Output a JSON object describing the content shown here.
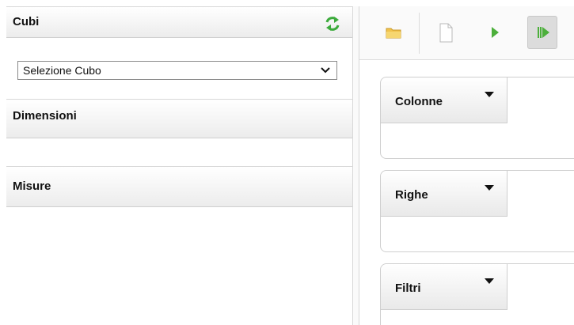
{
  "left_panel": {
    "cubi": {
      "title": "Cubi",
      "refresh_icon": "refresh-icon"
    },
    "cube_select": {
      "selected": "Selezione Cubo",
      "chevron": "chevron-down-icon"
    },
    "dimensioni": {
      "title": "Dimensioni"
    },
    "misure": {
      "title": "Misure"
    }
  },
  "toolbar": {
    "buttons": [
      {
        "icon": "folder-icon"
      },
      {
        "icon": "new-document-icon"
      },
      {
        "icon": "play-icon"
      },
      {
        "icon": "run-all-icon",
        "active": true
      }
    ]
  },
  "drop_areas": {
    "colonne": {
      "label": "Colonne"
    },
    "righe": {
      "label": "Righe"
    },
    "filtri": {
      "label": "Filtri"
    }
  },
  "colors": {
    "refresh_green": "#3cab3c",
    "play_green": "#4caf3b",
    "folder_yellow": "#f1c34c"
  }
}
